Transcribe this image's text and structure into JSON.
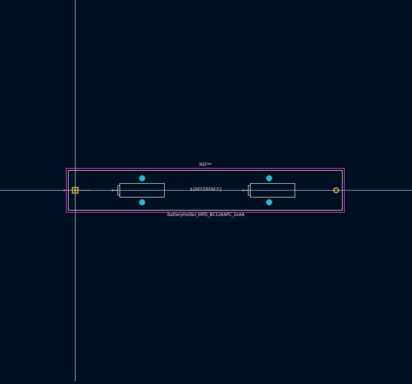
{
  "footprint": {
    "reference": "REF**",
    "value_field": "${REFERENCE}",
    "name": "BatteryHolder_MPD_BC12AAPC_2xAA",
    "plus_sign": "+"
  },
  "colors": {
    "background": "#001023",
    "grid": "#2c3a4f",
    "crosshair": "#c8c8c8",
    "courtyard": "#ff26e2",
    "fab": "#f2edd9",
    "silk": "#f2edd9",
    "pad": "#e9c13b",
    "mounting_hole": "#33b7d1",
    "ref_text": "#f2edd9",
    "value_text": "#e6e0cc",
    "name_text": "#f2edd9"
  }
}
